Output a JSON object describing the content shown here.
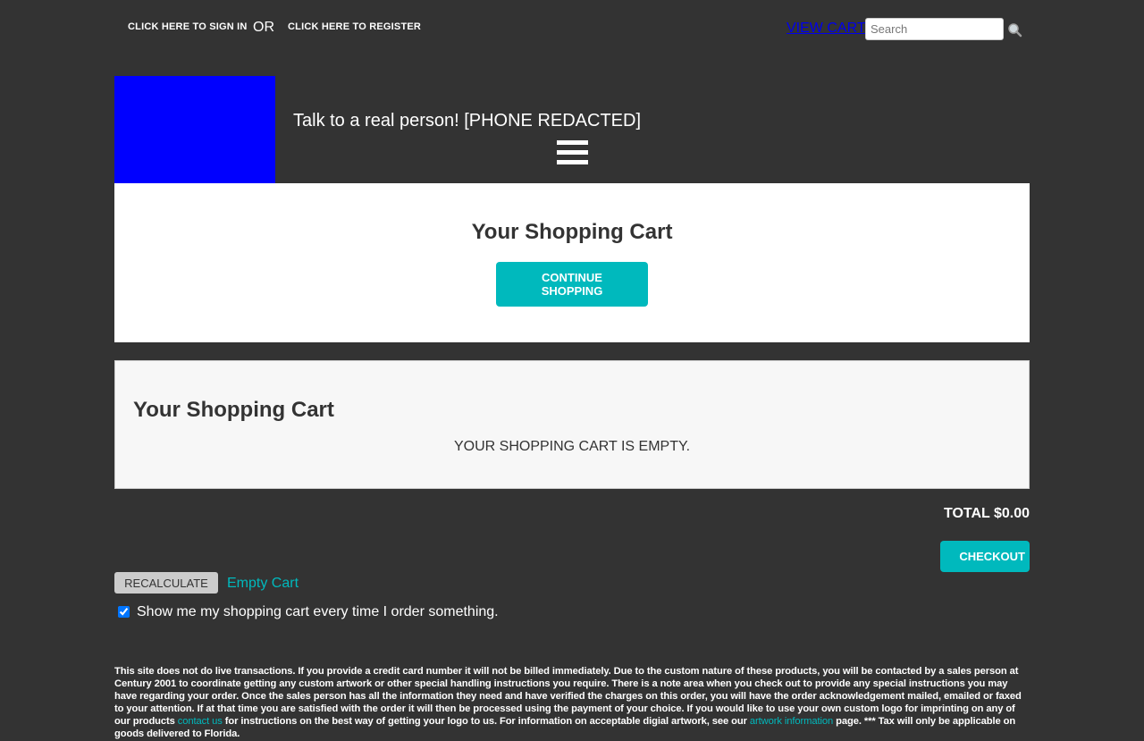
{
  "topbar": {
    "signin_label": "CLICK HERE TO SIGN IN",
    "or_label": "OR",
    "register_label": "CLICK HERE TO REGISTER",
    "viewcart_label": "VIEW CART",
    "search_placeholder": "Search",
    "search_icon": "magnifier-icon"
  },
  "header": {
    "phone_text": "Talk to a real person! [PHONE REDACTED]",
    "menu_icon": "hamburger-menu-icon",
    "logo_color": "#0000ff"
  },
  "cart_header": {
    "title": "Your Shopping Cart",
    "continue_label": "CONTINUE SHOPPING"
  },
  "cart_box": {
    "title": "Your Shopping Cart",
    "empty_message": "YOUR SHOPPING CART IS EMPTY."
  },
  "summary": {
    "total_label": "TOTAL $0.00",
    "checkout_label": "CHECKOUT",
    "recalculate_label": "RECALCULATE",
    "empty_cart_label": "Empty Cart",
    "show_cart_label": "Show me my shopping cart every time I order something.",
    "show_cart_checked": true
  },
  "footer": {
    "text_1": "This site does not do live transactions. If you provide a credit card number it will not be billed immediately. Due to the custom nature of these products, you will be contacted by a sales person at Century 2001 to coordinate getting any custom artwork or other special handling instructions you require. There is a note area when you check out to provide any special instructions you may have regarding your order. Once the sales person has all the information they need and have verified the charges on this order, you will have the order acknowledgement mailed, emailed or faxed to your attention. If at that time you are satisfied with the order it will then be processed using the payment of your choice. If you would like to use your own custom logo for imprinting on any of our products ",
    "contact_link": "contact us",
    "text_2": " for instructions on the best way of getting your logo to us. For information on acceptable digial artwork, see our ",
    "artwork_link": "artwork information",
    "text_3": " page. *** Tax will only be applicable on goods delivered to Florida."
  },
  "colors": {
    "background": "#333333",
    "accent": "#00b9bd",
    "link": "#0000ee"
  }
}
